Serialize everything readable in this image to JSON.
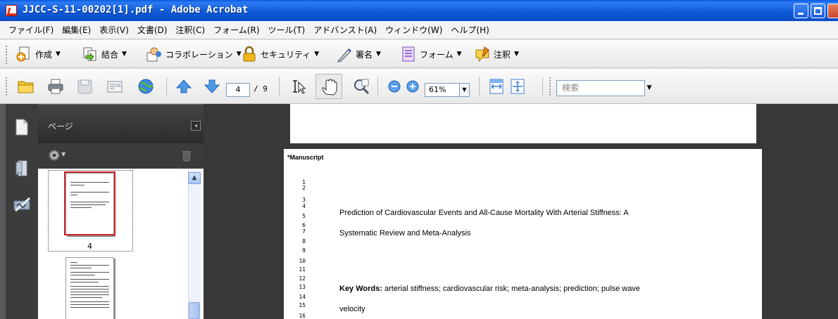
{
  "window": {
    "title": "JJCC-S-11-00202[1].pdf - Adobe Acrobat"
  },
  "menu": [
    "ファイル(F)",
    "編集(E)",
    "表示(V)",
    "文書(D)",
    "注釈(C)",
    "フォーム(R)",
    "ツール(T)",
    "アドバンスト(A)",
    "ウィンドウ(W)",
    "ヘルプ(H)"
  ],
  "tasks": [
    {
      "label": "作成",
      "icon": "create-pdf-icon"
    },
    {
      "label": "結合",
      "icon": "combine-icon"
    },
    {
      "label": "コラボレーション",
      "icon": "collaborate-icon"
    },
    {
      "label": "セキュリティ",
      "icon": "lock-icon"
    },
    {
      "label": "署名",
      "icon": "pen-icon"
    },
    {
      "label": "フォーム",
      "icon": "form-icon"
    },
    {
      "label": "注釈",
      "icon": "comment-icon"
    }
  ],
  "toolbar": {
    "current_page": "4",
    "total_pages": "/ 9",
    "zoom": "61%",
    "search_placeholder": "検索"
  },
  "nav_panel": {
    "title": "ページ",
    "thumbnail_label": "4"
  },
  "document": {
    "manuscript_label": "*Manuscript",
    "line_numbers": [
      "1",
      "2",
      "3",
      "4",
      "5",
      "6",
      "7",
      "8",
      "9",
      "10",
      "11",
      "12",
      "13",
      "14",
      "15",
      "16"
    ],
    "title_line1": "Prediction of Cardiovascular Events and All-Cause Mortality With Arterial Stiffness: A",
    "title_line2": "Systematic Review and Meta-Analysis",
    "keywords_label": "Key Words:",
    "keywords_text": " arterial stiffness; cardiovascular risk; meta-analysis; prediction; pulse wave",
    "keywords_cont": "velocity"
  }
}
